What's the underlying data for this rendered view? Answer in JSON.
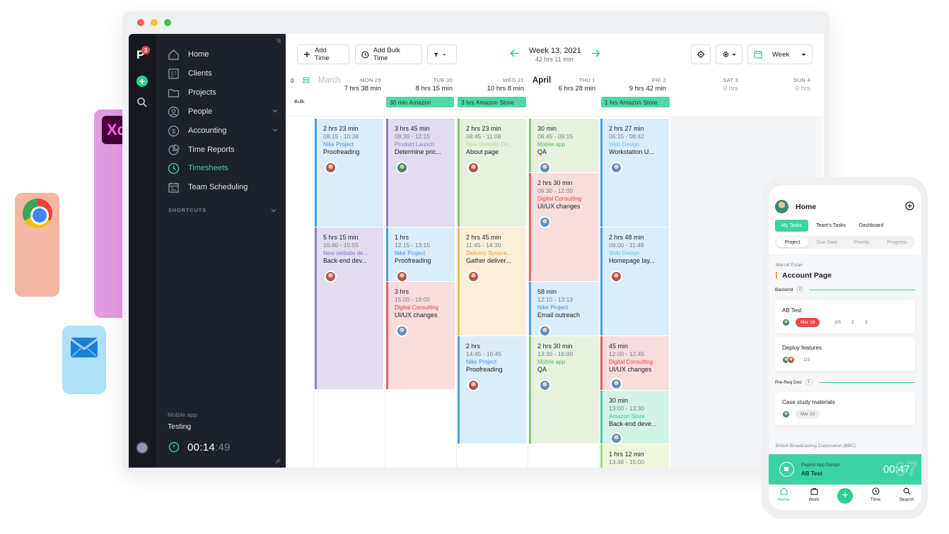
{
  "deco": {
    "xd_label": "Xd"
  },
  "logo": {
    "badge": "3"
  },
  "sidebar": {
    "items": [
      {
        "label": "Home"
      },
      {
        "label": "Clients"
      },
      {
        "label": "Projects"
      },
      {
        "label": "People"
      },
      {
        "label": "Accounting"
      },
      {
        "label": "Time Reports"
      },
      {
        "label": "Timesheets"
      },
      {
        "label": "Team Scheduling"
      }
    ],
    "shortcuts": "SHORTCUTS",
    "timer_project": "Mobile app",
    "timer_task": "Testing",
    "timer_main": "00:14",
    "timer_seconds": ":49"
  },
  "toolbar": {
    "add_time": "Add Time",
    "add_bulk_time": "Add Bulk Time",
    "week_title": "Week 13, 2021",
    "week_hours": "42 hrs 11 min",
    "view": "Week"
  },
  "calendar": {
    "month_march": "March",
    "month_april": "April",
    "bulk_label": "Bulk",
    "days": [
      {
        "name": "MON 29",
        "hours": "7 hrs 38 min"
      },
      {
        "name": "TUE 30",
        "hours": "8 hrs 15 min"
      },
      {
        "name": "WED 31",
        "hours": "10 hrs 8 min"
      },
      {
        "name": "THU 1",
        "hours": "6 hrs 28 min"
      },
      {
        "name": "FRI 2",
        "hours": "9 hrs 42 min"
      },
      {
        "name": "SAT 3",
        "hours": "0 hrs"
      },
      {
        "name": "SUN 4",
        "hours": "0 hrs"
      }
    ],
    "bulk": [
      {
        "label": "30 min Amazon"
      },
      {
        "label": "3 hrs Amazon Store"
      },
      {
        "label": "1 hrs Amazon Store"
      }
    ],
    "entries": [
      {
        "dur": "2 hrs 23 min",
        "time": "08:15 - 10:38",
        "project": "Nike Project",
        "task": "Proofreading"
      },
      {
        "dur": "5 hrs 15 min",
        "time": "10:40 - 15:55",
        "project": "New website de...",
        "task": "Back-end dev..."
      },
      {
        "dur": "3 hrs 45 min",
        "time": "08:30 - 12:15",
        "project": "Product Launch",
        "task": "Determine pric..."
      },
      {
        "dur": "1 hrs",
        "time": "12:15 - 13:15",
        "project": "Nike Project",
        "task": "Proofreading"
      },
      {
        "dur": "3 hrs",
        "time": "15:00 - 18:00",
        "project": "Digital Consulting",
        "task": "UI/UX changes"
      },
      {
        "dur": "2 hrs 23 min",
        "time": "08:45 - 11:08",
        "project": "New Website De...",
        "task": "About page"
      },
      {
        "dur": "2 hrs 45 min",
        "time": "11:45 - 14:30",
        "project": "Delivery System...",
        "task": "Gather deliver..."
      },
      {
        "dur": "2 hrs",
        "time": "14:45 - 16:45",
        "project": "Nike Project",
        "task": "Proofreading"
      },
      {
        "dur": "30 min",
        "time": "08:45 - 09:15",
        "project": "Mobile app",
        "task": "QA"
      },
      {
        "dur": "2 hrs 30 min",
        "time": "09:30 - 12:00",
        "project": "Digital Consulting",
        "task": "UI/UX changes"
      },
      {
        "dur": "58 min",
        "time": "12:15 - 13:13",
        "project": "Nike Project",
        "task": "Email outreach"
      },
      {
        "dur": "2 hrs 30 min",
        "time": "13:30 - 16:00",
        "project": "Mobile app",
        "task": "QA"
      },
      {
        "dur": "2 hrs 27 min",
        "time": "06:15 - 08:42",
        "project": "Web Design",
        "task": "Workstation U..."
      },
      {
        "dur": "2 hrs 48 min",
        "time": "09:00 - 11:48",
        "project": "Web Design",
        "task": "Homepage lay..."
      },
      {
        "dur": "45 min",
        "time": "12:00 - 12:45",
        "project": "Digital Consulting",
        "task": "UI/UX changes"
      },
      {
        "dur": "30 min",
        "time": "13:00 - 13:30",
        "project": "Amazon Store",
        "task": "Back-end deve..."
      },
      {
        "dur": "1 hrs 12 min",
        "time": "13:48 - 15:00",
        "project": "",
        "task": ""
      }
    ]
  },
  "phone": {
    "title": "Home",
    "tabs": [
      "My Tasks",
      "Team's Tasks",
      "Dashboard"
    ],
    "segments": [
      "Project",
      "Due Date",
      "Priority",
      "Progress"
    ],
    "client": "Marcel Evian",
    "page": "Account Page",
    "section_backend": "Backend",
    "section_backend_count": "2",
    "section_prereq": "Pre-Req Doc",
    "section_prereq_count": "1",
    "cards": [
      {
        "title": "AB Test",
        "date": "Mar 18",
        "subtasks": "3/5",
        "comments": "2",
        "files": "3"
      },
      {
        "title": "Deploy features",
        "subtasks": "1/3"
      },
      {
        "title": "Case study materials",
        "date": "Mar 23"
      }
    ],
    "next_client": "British Broadcasting Corporation (BBC)",
    "timer_project": "Paymo App Design",
    "timer_task": "AB Test",
    "timer_time": "00:47",
    "timer_ghost": "07",
    "nav": [
      "Home",
      "Work",
      "Time",
      "Search"
    ]
  },
  "colors": {
    "accent": "#3dd2a3",
    "sidebar": "#1d2129",
    "active_nav": "#45d3a8"
  }
}
